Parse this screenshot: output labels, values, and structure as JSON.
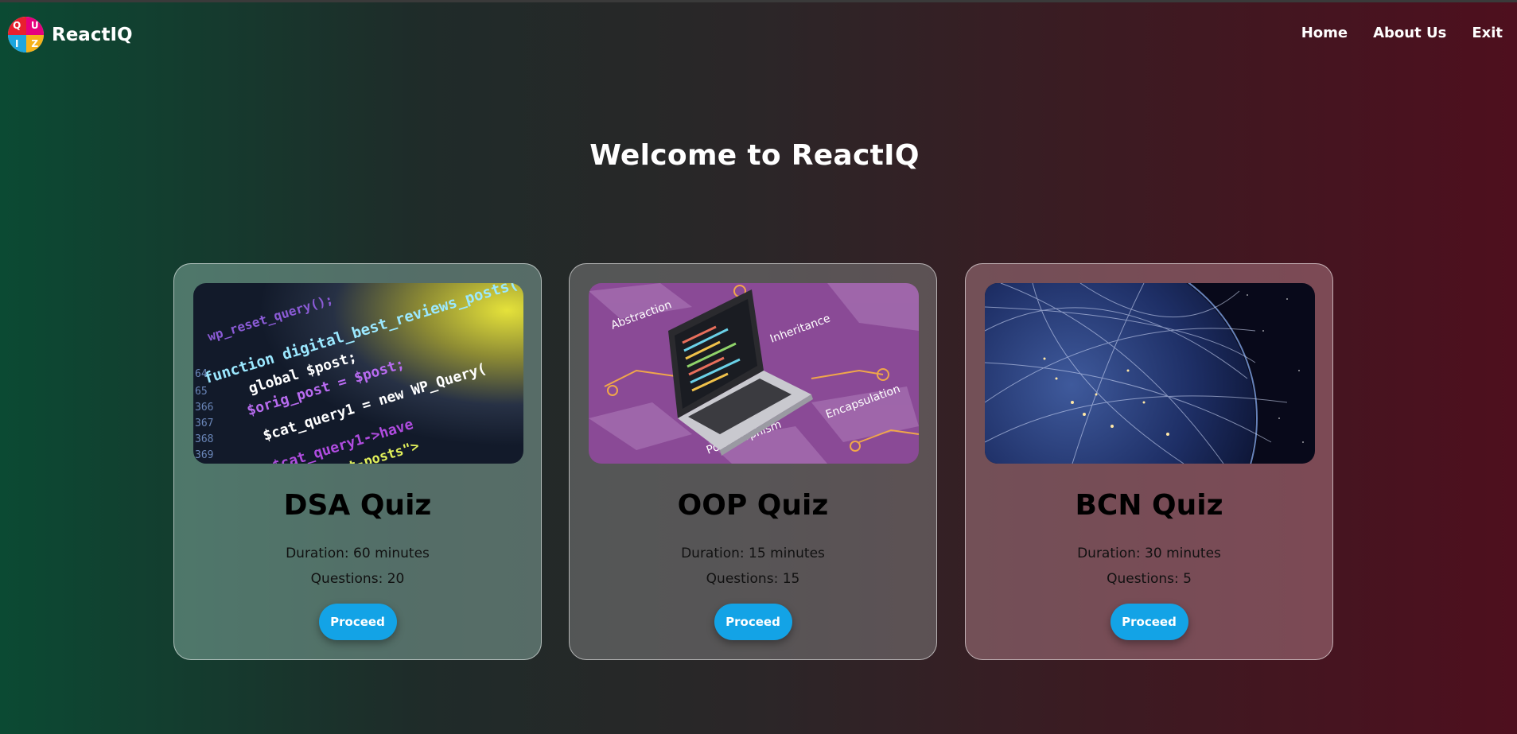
{
  "brand": {
    "name": "ReactIQ",
    "logo_letters": [
      "Q",
      "U",
      "I",
      "Z"
    ]
  },
  "nav": {
    "links": [
      "Home",
      "About Us",
      "Exit"
    ]
  },
  "page": {
    "title": "Welcome to ReactIQ"
  },
  "quizzes": [
    {
      "title": "DSA Quiz",
      "duration": "Duration: 60 minutes",
      "questions": "Questions: 20",
      "button": "Proceed",
      "image_code_lines": [
        "wp_reset_query();",
        "function digital_best_reviews_posts(",
        "global $post;",
        "$orig_post = $post;",
        "$cat_query1 = new WP_Query(",
        "$cat_query1->have",
        "widget-posts\">"
      ],
      "image_line_numbers": [
        "64",
        "65",
        "366",
        "367",
        "368",
        "369"
      ]
    },
    {
      "title": "OOP Quiz",
      "duration": "Duration: 15 minutes",
      "questions": "Questions: 15",
      "button": "Proceed",
      "image_labels": [
        "Abstraction",
        "Inheritance",
        "Polymorphism",
        "Encapsulation"
      ]
    },
    {
      "title": "BCN Quiz",
      "duration": "Duration: 30 minutes",
      "questions": "Questions: 5",
      "button": "Proceed"
    }
  ],
  "colors": {
    "accent": "#13a3e6",
    "bg_left": "#0b4a33",
    "bg_right": "#4e0f1e",
    "oop_purple": "#8a4a96"
  },
  "icons": [
    "quiz-logo-icon"
  ]
}
